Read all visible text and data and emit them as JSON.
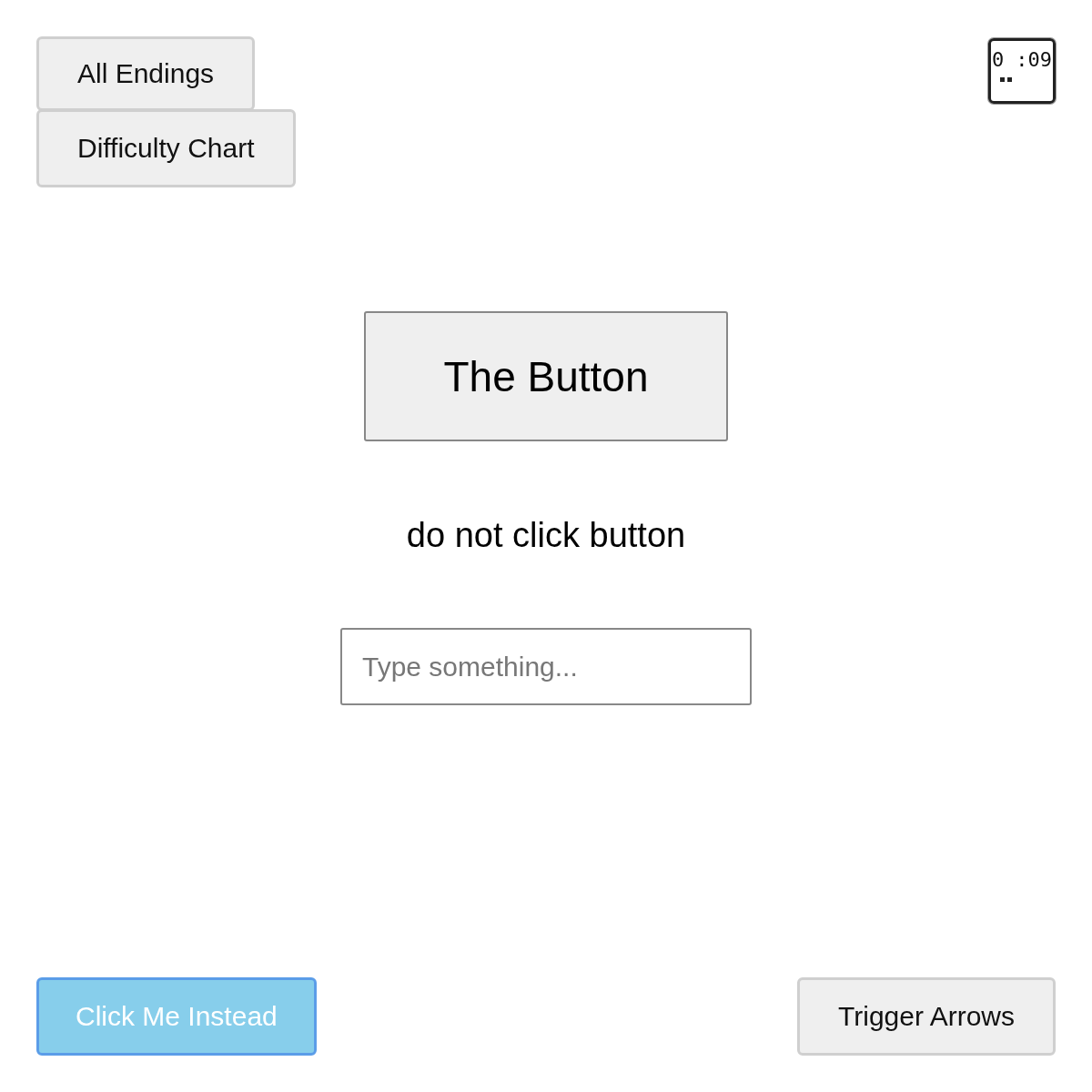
{
  "top_buttons": [
    "All Endings",
    "Difficulty Chart"
  ],
  "timer": {
    "text": "0 :09"
  },
  "main_button": "The Button",
  "instruction": "do not click button",
  "input": {
    "placeholder": "Type something..."
  },
  "bottom_buttons": [
    {
      "label": "Click Me Instead",
      "kind": "primary"
    },
    {
      "label": "Trigger Arrows",
      "kind": "secondary"
    }
  ]
}
